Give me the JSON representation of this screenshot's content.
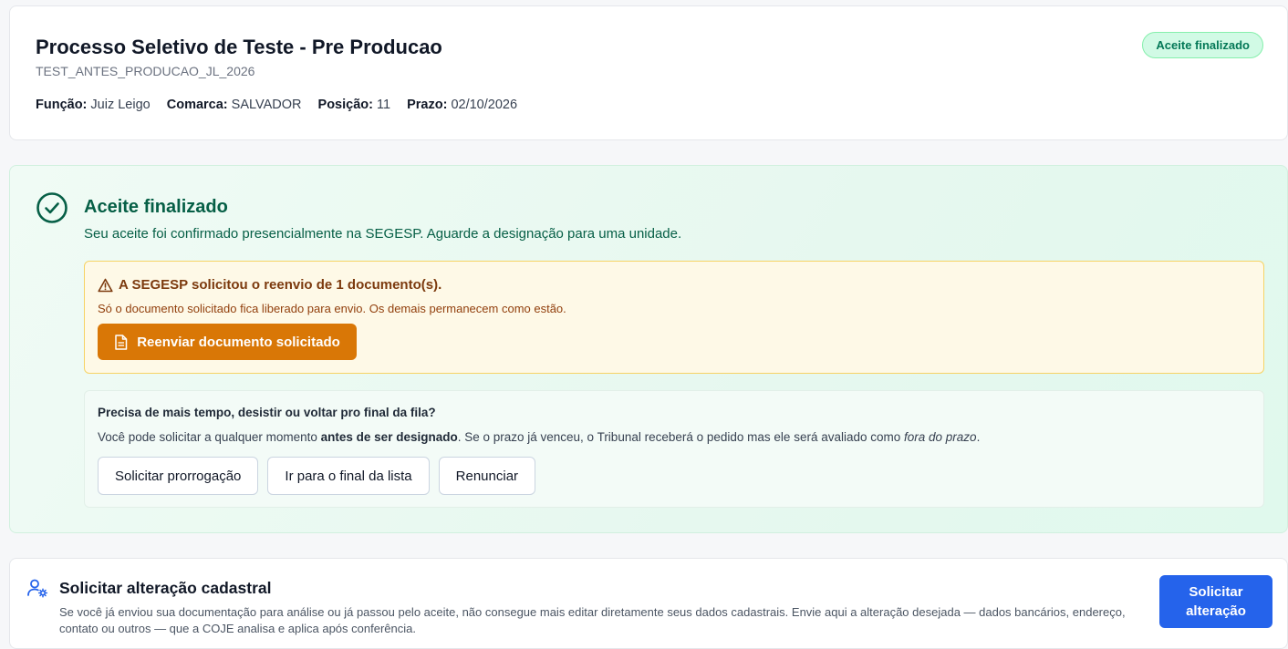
{
  "process": {
    "title": "Processo Seletivo de Teste - Pre Producao",
    "code": "TEST_ANTES_PRODUCAO_JL_2026",
    "status_badge": "Aceite finalizado",
    "meta": {
      "funcao_label": "Função:",
      "funcao_value": "Juiz Leigo",
      "comarca_label": "Comarca:",
      "comarca_value": "SALVADOR",
      "posicao_label": "Posição:",
      "posicao_value": "11",
      "prazo_label": "Prazo:",
      "prazo_value": "02/10/2026"
    }
  },
  "status": {
    "icon": "check-circle-icon",
    "title": "Aceite finalizado",
    "message": "Seu aceite foi confirmado presencialmente na SEGESP. Aguarde a designação para uma unidade."
  },
  "resend": {
    "icon": "warning-triangle-icon",
    "title": "A SEGESP solicitou o reenvio de 1 documento(s).",
    "message": "Só o documento solicitado fica liberado para envio. Os demais permanecem como estão.",
    "button_label": "Reenviar documento solicitado",
    "button_icon": "document-icon"
  },
  "help": {
    "title": "Precisa de mais tempo, desistir ou voltar pro final da fila?",
    "msg_part1": "Você pode solicitar a qualquer momento ",
    "msg_bold": "antes de ser designado",
    "msg_part2": ". Se o prazo já venceu, o Tribunal receberá o pedido mas ele será avaliado como ",
    "msg_italic": "fora do prazo",
    "msg_part3": ".",
    "buttons": {
      "prorrogacao": "Solicitar prorrogação",
      "final_lista": "Ir para o final da lista",
      "renunciar": "Renunciar"
    }
  },
  "alteracao": {
    "icon": "user-settings-icon",
    "title": "Solicitar alteração cadastral",
    "description": "Se você já enviou sua documentação para análise ou já passou pelo aceite, não consegue mais editar diretamente seus dados cadastrais. Envie aqui a alteração desejada — dados bancários, endereço, contato ou outros — que a COJE analisa e aplica após conferência.",
    "button_label": "Solicitar alteração"
  },
  "colors": {
    "accent_blue": "#2563eb",
    "warning_orange": "#d97706",
    "success_green": "#065f46"
  }
}
